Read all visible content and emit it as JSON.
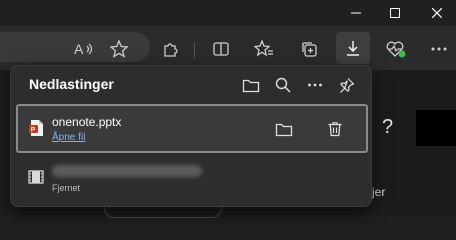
{
  "downloads": {
    "title": "Nedlastinger",
    "header_icons": [
      "folder-icon",
      "search-icon",
      "more-icon",
      "pin-icon"
    ],
    "items": [
      {
        "file_name": "onenote.pptx",
        "action_link": "Åpne fil",
        "file_type_icon": "powerpoint-icon",
        "actions": [
          "open-folder-icon",
          "delete-icon"
        ]
      },
      {
        "file_name": "",
        "status": "Fjernet",
        "file_type_icon": "video-file-icon"
      }
    ]
  },
  "page": {
    "help_glyph": "?",
    "partial_text": "jer"
  },
  "colors": {
    "panel_bg": "#2d2d2d",
    "link": "#7fb6f0",
    "selected_border": "#8a8a8a",
    "toolbar_bg": "#2b2b2b"
  }
}
